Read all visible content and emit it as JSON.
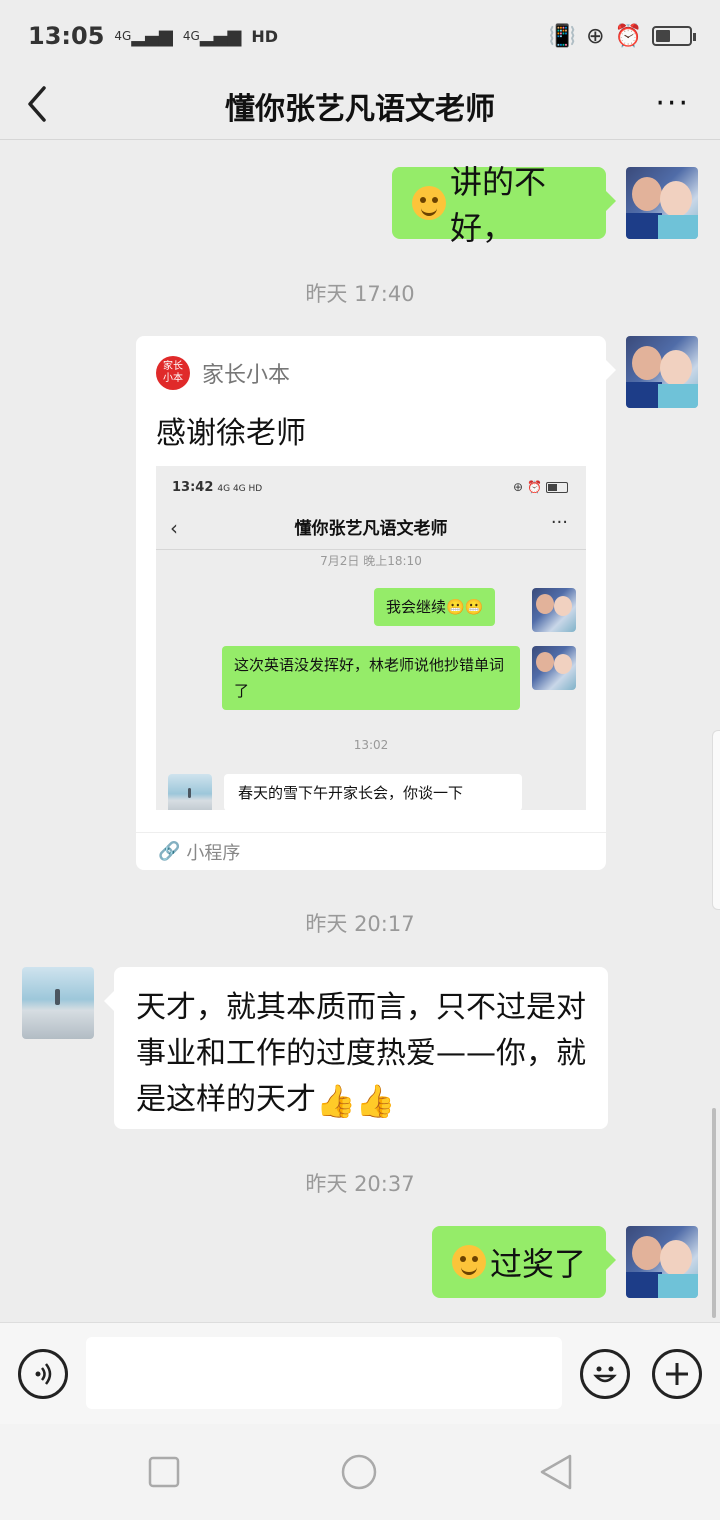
{
  "status": {
    "time": "13:05",
    "signal1": "4G",
    "signal2": "4G",
    "hd": "HD",
    "battery_level": 0.45
  },
  "nav": {
    "title": "懂你张艺凡语文老师",
    "more": "···"
  },
  "messages": {
    "m1_text": "讲的不好，",
    "ts1": "昨天 17:40",
    "card": {
      "source": "家长小本",
      "logo_text": "家长小本",
      "title": "感谢徐老师",
      "footer": "小程序",
      "shot": {
        "time": "13:42",
        "signal": "4G 4G HD",
        "nav_title": "懂你张艺凡语文老师",
        "ts1": "7月2日 晚上18:10",
        "msg1": "我会继续",
        "msg2": "这次英语没发挥好，林老师说他抄错单词了",
        "ts2": "13:02",
        "msg3": "春天的雪下午开家长会，你谈一下"
      }
    },
    "ts2": "昨天 20:17",
    "m2_text": "天才，就其本质而言，只不过是对事业和工作的过度热爱——你，就是这样的天才",
    "ts3": "昨天 20:37",
    "m3_text": "过奖了"
  },
  "input": {
    "placeholder": ""
  },
  "colors": {
    "bubble_green": "#95ec69",
    "background": "#ededed"
  }
}
